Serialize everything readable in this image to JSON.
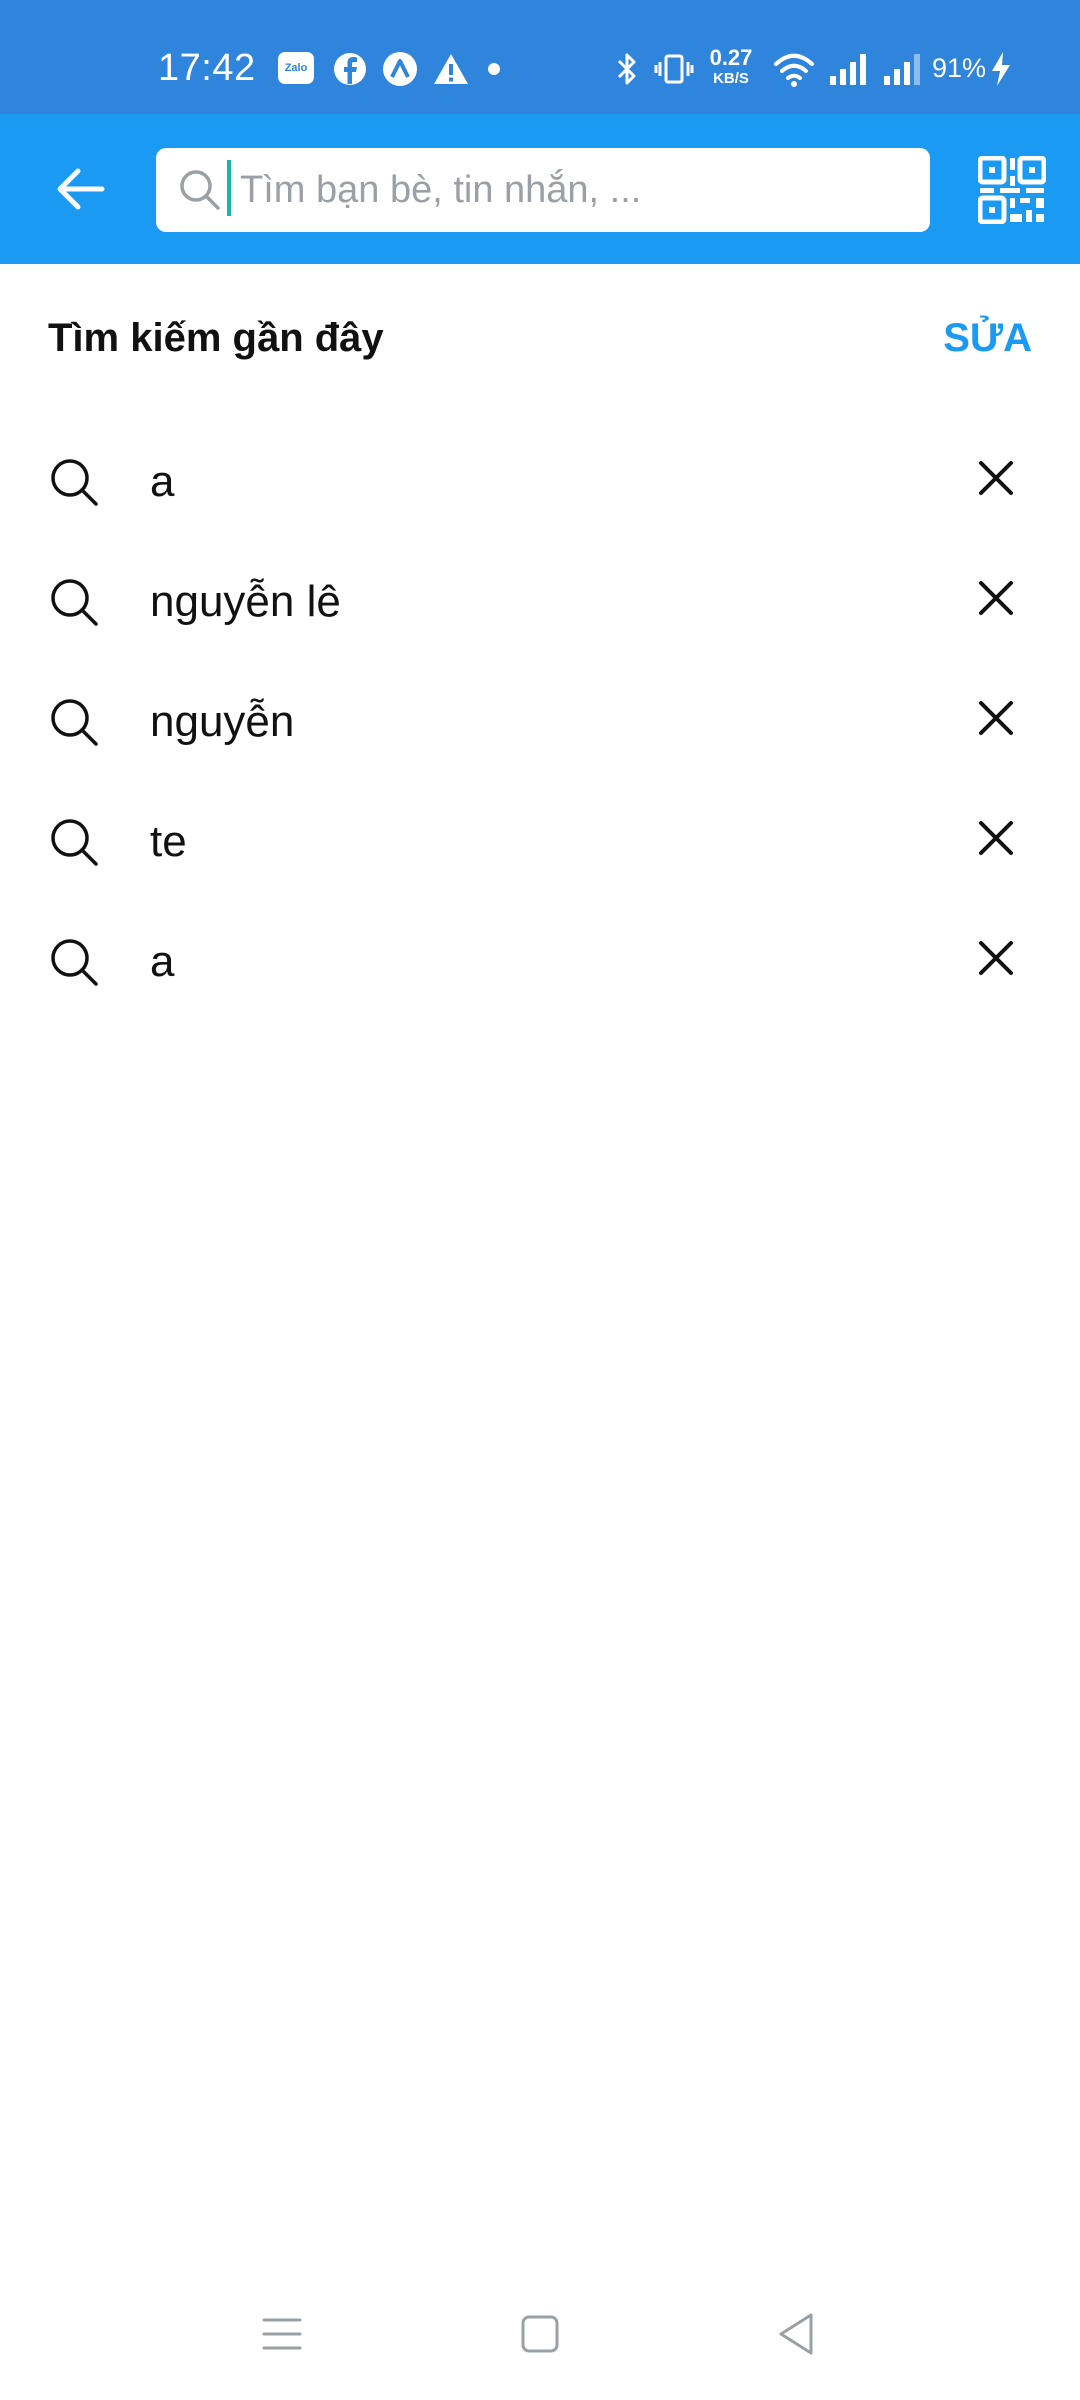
{
  "status_bar": {
    "time": "17:42",
    "notification_icons": [
      "zalo-icon",
      "facebook-icon",
      "app-icon",
      "warning-icon",
      "dot-icon"
    ],
    "zalo_badge": "Zalo",
    "network_speed_value": "0.27",
    "network_speed_unit": "KB/S",
    "battery_percent": "91%"
  },
  "app_bar": {
    "search_placeholder": "Tìm bạn bè, tin nhắn, ...",
    "search_value": ""
  },
  "recent": {
    "title": "Tìm kiếm gần đây",
    "edit_label": "SỬA",
    "items": [
      {
        "text": "a"
      },
      {
        "text": "nguyễn lê"
      },
      {
        "text": "nguyễn"
      },
      {
        "text": "te"
      },
      {
        "text": "a"
      }
    ]
  },
  "colors": {
    "status_bar": "#2f84dc",
    "app_bar": "#1a9af2",
    "accent": "#1a9af2",
    "cursor": "#14b8a6"
  }
}
